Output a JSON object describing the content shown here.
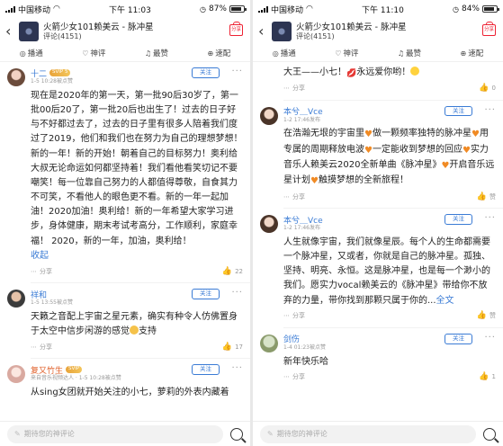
{
  "left": {
    "status": {
      "carrier": "中国移动",
      "time": "下午 11:03",
      "battery_text": "87%",
      "battery_level": 0.87
    },
    "header": {
      "title": "火箭少女101赖美云 - 脉冲星",
      "comment_label": "评论(4151)"
    },
    "tabs": [
      {
        "icon": "◎",
        "label": "播通"
      },
      {
        "icon": "♡",
        "label": "神评"
      },
      {
        "icon": "♫",
        "label": "最赞"
      },
      {
        "icon": "⊕",
        "label": "速配"
      }
    ],
    "comments": [
      {
        "username": "十二",
        "vip": "SVIP 5",
        "meta": "1-5 10:28被点赞",
        "follow": "关注",
        "content": "现在是2020年的第一天，第一批90后30岁了，第一批00后20了，第一批20后也出生了！过去的日子好与不好都过去了，过去的日子里有很多人陪着我们度过了2019，他们和我们也在努力为自己的理想梦想！新的一年！新的开始！朝着自己的目标努力！奥利给大叔无论命运如何都坚持着！我们看他看笑切记不要嘲笑！每一位靠自己努力的人都值得尊敬，自食其力不可笑，不看他人的眼色更不看。新的一年一起加油！2020加油！奥利给！新的一年希望大家学习进步，身体健康，期末考试考高分，工作顺利，家庭幸福！ 2020，新的一年，加油，奥利给！",
        "collapse": "收起",
        "share": "分享",
        "likes": "22"
      },
      {
        "username": "祥和",
        "meta": "1-5 13:55被点赞",
        "follow": "关注",
        "content": "天籁之音配上宇宙之星元素，确实有种令人仿佛置身于太空中信步闲游的感觉",
        "content_tail": "支持",
        "share": "分享",
        "likes": "17"
      },
      {
        "username": "复又竹生",
        "vip": "SVIP",
        "meta": "来自音乐视频达人 · 1-5 10:28被点赞",
        "follow": "关注",
        "content": "从sing女团就开始关注的小七，萝莉的外表内藏着"
      }
    ],
    "input_placeholder": "期待您的神评论"
  },
  "right": {
    "status": {
      "carrier": "中国移动",
      "time": "下午 11:10",
      "battery_text": "84%",
      "battery_level": 0.84
    },
    "header": {
      "title": "火箭少女101赖美云 - 脉冲星",
      "comment_label": "评论(4151)"
    },
    "tabs": [
      {
        "icon": "◎",
        "label": "播通"
      },
      {
        "icon": "♡",
        "label": "神评"
      },
      {
        "icon": "♫",
        "label": "最赞"
      },
      {
        "icon": "⊕",
        "label": "速配"
      }
    ],
    "top_partial": {
      "content": "大王——小七！",
      "content_mid": "永远爱你哟！",
      "share": "分享",
      "likes": "0"
    },
    "comments": [
      {
        "username": "本兮＿Vce",
        "meta": "1-2 17:46发布",
        "follow": "关注",
        "content_parts": [
          "在浩瀚无垠的宇宙里",
          "做一颗频率独特的脉冲星",
          "用专属的周期释放电波",
          "一定能收到梦想的回应",
          "实力音乐人赖美云2020全新单曲《脉冲星》",
          "开启音乐远星计划",
          "触摸梦想的全新旅程！"
        ],
        "share": "分享",
        "likes": "赞"
      },
      {
        "username": "本兮＿Vce",
        "meta": "1-2 17:46发布",
        "follow": "关注",
        "content": "人生就像宇宙，我们就像星辰。每个人的生命都需要一个脉冲星，又或者，你就是自己的脉冲星。孤独、坚持、明亮、永恒。这是脉冲星，也是每一个渺小的我们。愿实力vocal赖美云的《脉冲星》带给你不放弃的力量，带你找到那颗只属于你的...",
        "more": "全文",
        "share": "分享",
        "likes": "赞"
      },
      {
        "username": "剑伤",
        "meta": "1-4 01:23被点赞",
        "follow": "关注",
        "content": "新年快乐哈",
        "share": "分享",
        "likes": "1"
      }
    ],
    "input_placeholder": "期待您的神评论"
  },
  "colors": {
    "link": "#3a7bd5",
    "accent_red": "#e22233",
    "vip_gold": "#e8a33a",
    "heart_orange": "#f08a24"
  }
}
